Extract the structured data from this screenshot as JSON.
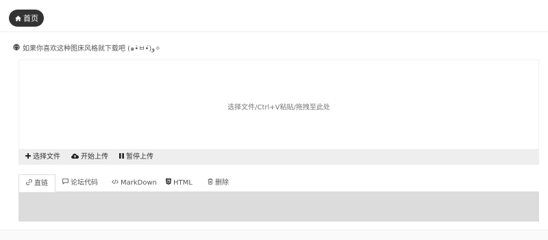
{
  "nav": {
    "home_label": "首页"
  },
  "promo": {
    "text": "如果你喜欢这种图床风格就下载吧 (๑•̀ㅂ•́)و✧"
  },
  "uploader": {
    "hint": "选择文件/Ctrl+V粘贴/拖拽至此处",
    "buttons": [
      {
        "label": "选择文件",
        "icon": "plus-icon"
      },
      {
        "label": "开始上传",
        "icon": "cloud-upload-icon"
      },
      {
        "label": "暂停上传",
        "icon": "pause-icon"
      }
    ]
  },
  "tabs": [
    {
      "label": "直链",
      "icon": "link-icon",
      "active": true
    },
    {
      "label": "论坛代码",
      "icon": "comment-icon",
      "active": false
    },
    {
      "label": "MarkDown",
      "icon": "code-icon",
      "active": false
    },
    {
      "label": "HTML",
      "icon": "html5-icon",
      "active": false
    },
    {
      "label": "删除",
      "icon": "trash-icon",
      "active": false
    }
  ],
  "colors": {
    "home_button_bg": "#333333",
    "toolbar_bg": "#eeeeee",
    "output_bg": "#dcdcdc"
  }
}
